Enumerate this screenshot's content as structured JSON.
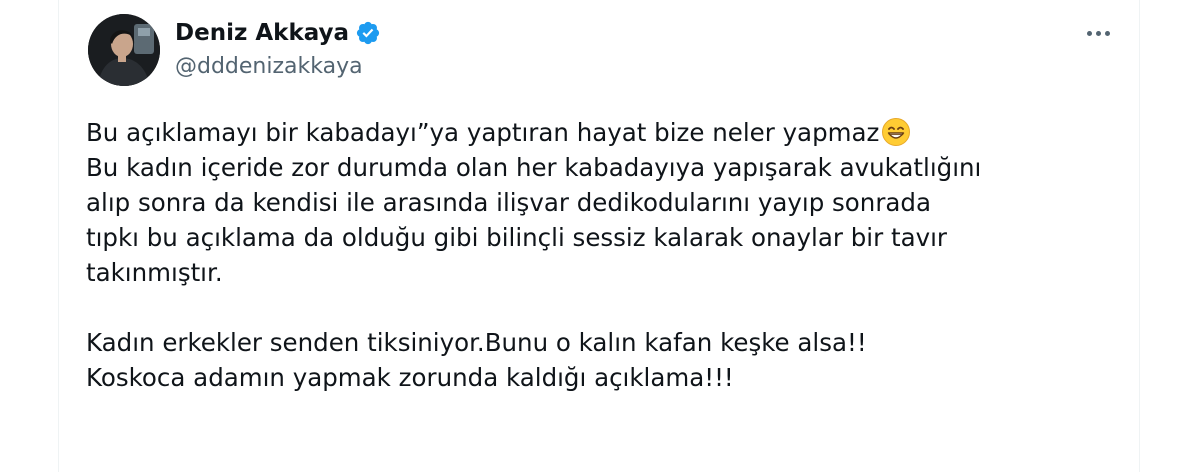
{
  "author": {
    "display_name": "Deniz Akkaya",
    "handle": "@dddenizakkaya",
    "verified": true,
    "accent_color": "#1d9bf0"
  },
  "icons": {
    "verified": "verified-badge-icon",
    "more": "more-options-icon",
    "emoji": "grinning-face-with-smiling-eyes-emoji"
  },
  "tweet": {
    "lines": [
      "Bu açıklamayı bir kabadayı”ya yaptıran hayat bize neler yapmaz",
      "Bu kadın içeride zor durumda olan her kabadayıya yapışarak avukatlığını",
      "alıp sonra da kendisi ile arasında ilişvar dedikodularını yayıp sonrada",
      "tıpkı bu açıklama da olduğu gibi bilinçli sessiz kalarak onaylar bir tavır",
      "takınmıştır.",
      "",
      "Kadın erkekler senden tiksiniyor.Bunu  o kalın kafan keşke alsa!!",
      "Koskoca adamın yapmak zorunda kaldığı açıklama!!!"
    ]
  }
}
